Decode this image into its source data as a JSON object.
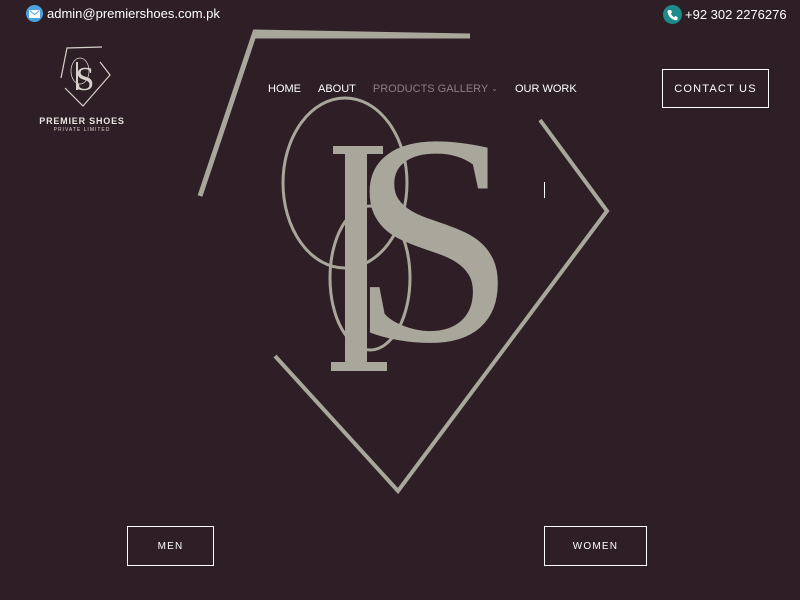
{
  "topbar": {
    "email": "admin@premiershoes.com.pk",
    "email_icon": "envelope-icon",
    "phone": "+92 302 2276276",
    "phone_icon": "phone-icon"
  },
  "brand": {
    "name": "PREMIER SHOES",
    "subtitle": "PRIVATE  LIMITED",
    "monogram": "PS"
  },
  "nav": {
    "items": [
      {
        "label": "HOME"
      },
      {
        "label": "ABOUT"
      },
      {
        "label": "PRODUCTS GALLERY",
        "has_dropdown": true
      },
      {
        "label": "OUR WORK"
      }
    ],
    "contact_label": "CONTACT US"
  },
  "hero": {
    "men_label": "MEN",
    "women_label": "WOMEN"
  },
  "colors": {
    "background": "#2d1f25",
    "monogram": "#a9a69c",
    "text": "#ffffff",
    "email_icon_bg": "#4aa3df",
    "phone_icon_bg": "#1c8c8a"
  }
}
